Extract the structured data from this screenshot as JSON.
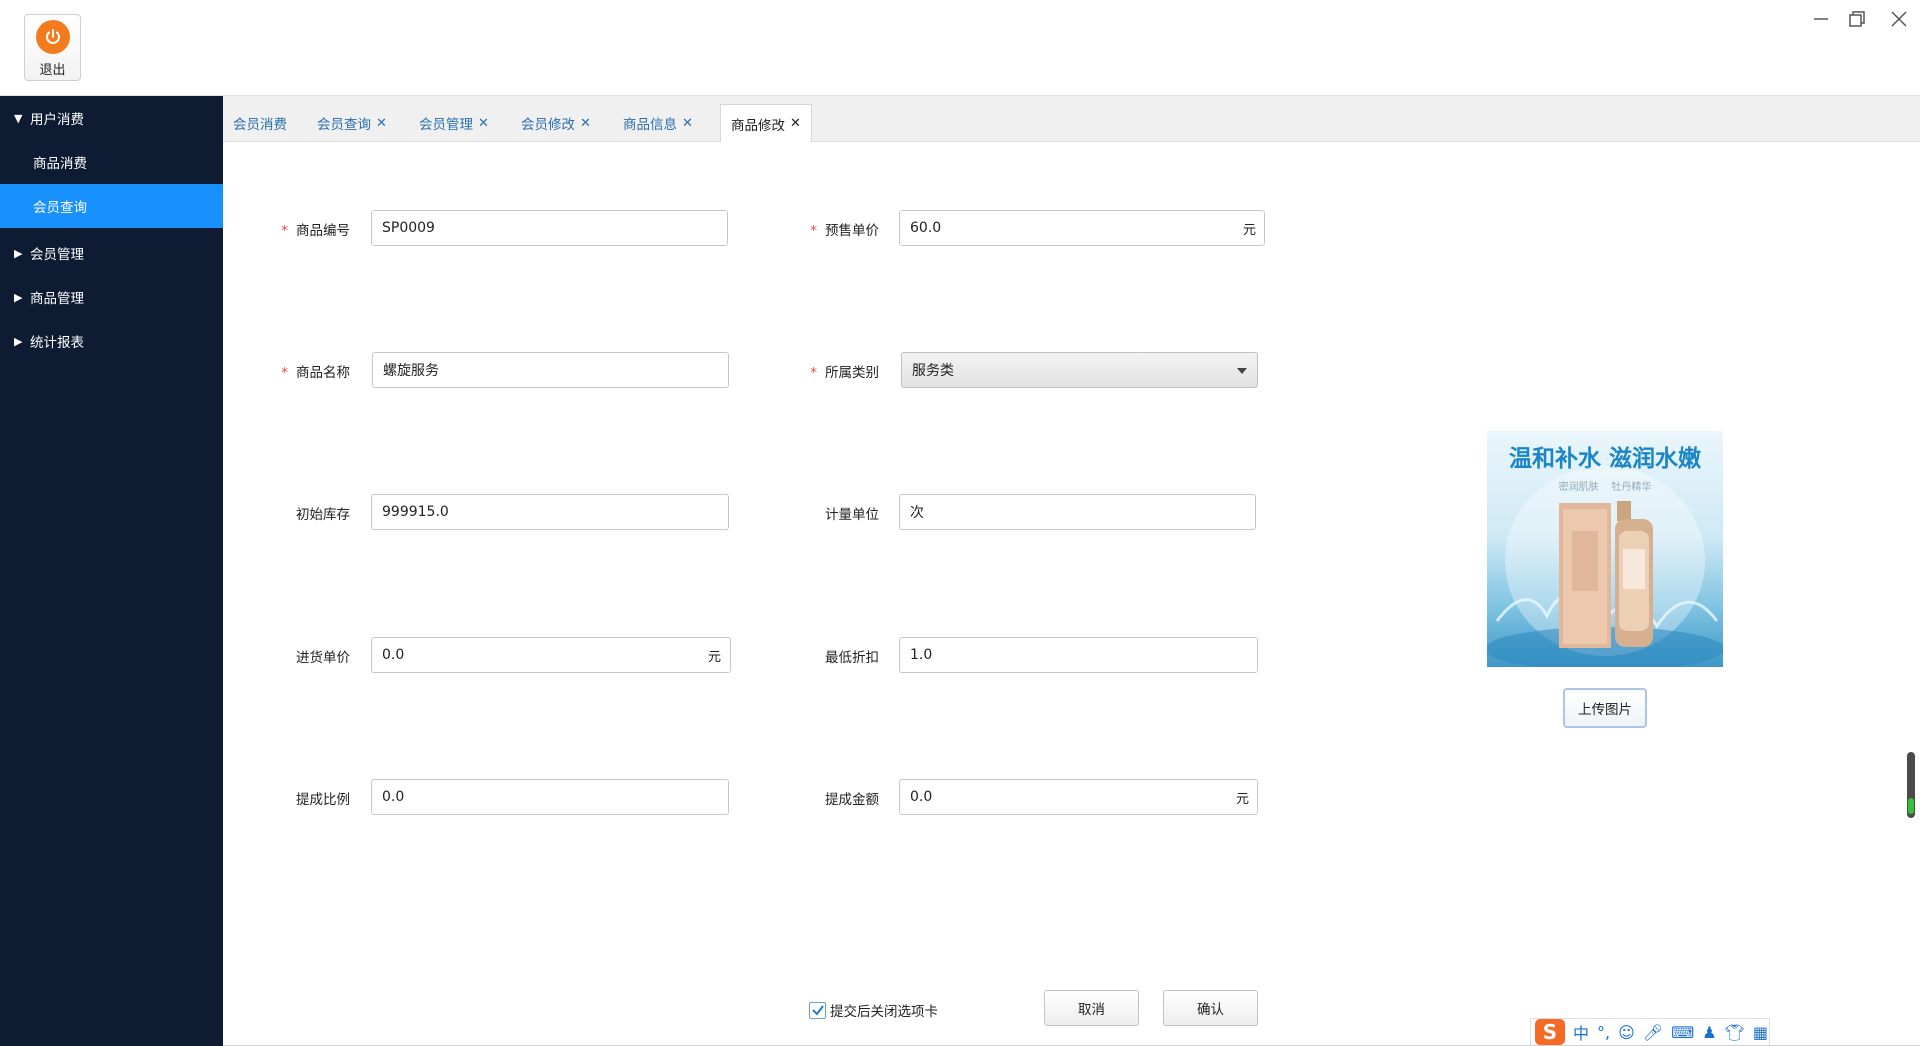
{
  "header": {
    "exit_label": "退出",
    "colors": {
      "exit_accent": "#f37b1d",
      "sidebar_bg": "#0d1b33",
      "active_nav": "#1891ff",
      "tab_link": "#2a6fb0",
      "required_mark": "#e44444"
    }
  },
  "sidebar": {
    "groups": [
      {
        "label": "用户消费",
        "expanded": true,
        "items": [
          "商品消费",
          "会员查询"
        ],
        "active_item": "会员查询"
      },
      {
        "label": "会员管理",
        "expanded": false
      },
      {
        "label": "商品管理",
        "expanded": false
      },
      {
        "label": "统计报表",
        "expanded": false
      }
    ]
  },
  "tabs": [
    {
      "label": "会员消费",
      "closable": false
    },
    {
      "label": "会员查询",
      "closable": true
    },
    {
      "label": "会员管理",
      "closable": true
    },
    {
      "label": "会员修改",
      "closable": true
    },
    {
      "label": "商品信息",
      "closable": true
    },
    {
      "label": "商品修改",
      "closable": true,
      "active": true
    }
  ],
  "tab_close_glyph": "✕",
  "form": {
    "required_mark": "*",
    "product_code": {
      "label": "商品编号",
      "value": "SP0009"
    },
    "presale_price": {
      "label": "预售单价",
      "value": "60.0",
      "unit": "元"
    },
    "product_name": {
      "label": "商品名称",
      "value": "螺旋服务"
    },
    "category": {
      "label": "所属类别",
      "value": "服务类"
    },
    "initial_stock": {
      "label": "初始库存",
      "value": "999915.0"
    },
    "measure_unit": {
      "label": "计量单位",
      "value": "次"
    },
    "purchase_price": {
      "label": "进货单价",
      "value": "0.0",
      "unit": "元"
    },
    "min_discount": {
      "label": "最低折扣",
      "value": "1.0"
    },
    "commission_ratio": {
      "label": "提成比例",
      "value": "0.0"
    },
    "commission_amount": {
      "label": "提成金额",
      "value": "0.0",
      "unit": "元"
    }
  },
  "image_panel": {
    "ad_headline": "温和补水 滋润水嫩",
    "ad_tag_1": "密润肌肤",
    "ad_tag_2": "牡丹精华",
    "upload_label": "上传图片"
  },
  "footer": {
    "close_tab_checkbox": {
      "label": "提交后关闭选项卡",
      "checked": true
    },
    "cancel_label": "取消",
    "confirm_label": "确认"
  },
  "ime": {
    "logo": "S",
    "lang": "中",
    "punct": "°,"
  }
}
